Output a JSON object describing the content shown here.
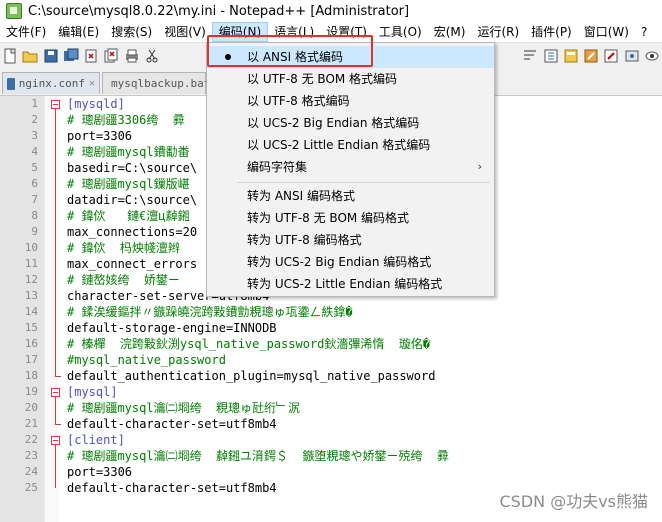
{
  "window": {
    "title": "C:\\source\\mysql8.0.22\\my.ini - Notepad++ [Administrator]"
  },
  "menubar": {
    "items": [
      "文件(F)",
      "编辑(E)",
      "搜索(S)",
      "视图(V)",
      "编码(N)",
      "语言(L)",
      "设置(T)",
      "工具(O)",
      "宏(M)",
      "运行(R)",
      "插件(P)",
      "窗口(W)",
      "?"
    ]
  },
  "tabs": [
    {
      "label": "nginx.conf"
    },
    {
      "label": "mysqlbackup.bat"
    }
  ],
  "encoding_menu": {
    "items": [
      {
        "label": "以 ANSI 格式编码",
        "checked": true
      },
      {
        "label": "以 UTF-8 无 BOM 格式编码"
      },
      {
        "label": "以 UTF-8 格式编码"
      },
      {
        "label": "以 UCS-2 Big Endian 格式编码"
      },
      {
        "label": "以 UCS-2 Little Endian 格式编码"
      },
      {
        "label": "编码字符集",
        "submenu": true
      },
      {
        "label": "转为 ANSI 编码格式"
      },
      {
        "label": "转为 UTF-8 无 BOM 编码格式"
      },
      {
        "label": "转为 UTF-8 编码格式"
      },
      {
        "label": "转为 UCS-2 Big Endian 编码格式"
      },
      {
        "label": "转为 UCS-2 Little Endian 编码格式"
      }
    ]
  },
  "editor": {
    "lines": [
      {
        "num": "1",
        "text": "[mysqld]",
        "kind": "section"
      },
      {
        "num": "2",
        "text": "# 璁剧疆3306绔  彛",
        "kind": "comment"
      },
      {
        "num": "3",
        "text": "port=3306",
        "kind": "normal"
      },
      {
        "num": "4",
        "text": "# 璁剧疆mysql鐨勫畨",
        "kind": "comment"
      },
      {
        "num": "5",
        "text": "basedir=C:\\source\\",
        "kind": "normal"
      },
      {
        "num": "6",
        "text": "# 璁剧疆mysql鏁版嵁",
        "kind": "comment"
      },
      {
        "num": "7",
        "text": "datadir=C:\\source\\",
        "kind": "normal"
      },
      {
        "num": "8",
        "text": "# 鍏佽   鏈€澶ц繛鎺",
        "kind": "comment"
      },
      {
        "num": "9",
        "text": "max_connections=20",
        "kind": "normal"
      },
      {
        "num": "10",
        "text": "# 鍏佽  杩炴帴澶辫",
        "kind": "comment"
      },
      {
        "num": "11",
        "text": "max_connect_errors",
        "kind": "normal"
      },
      {
        "num": "12",
        "text": "# 鏈嶅姟绔  娇鐢ㄧ",
        "kind": "comment"
      },
      {
        "num": "13",
        "text": "character-set-server=utf8mb4",
        "kind": "normal"
      },
      {
        "num": "14",
        "text": "# 鍒涘缓鏂拌〃鏃跺皢浣跨敤鐨勯粯璁ゅ瓨鍌ㄥ紩鎿�",
        "kind": "comment"
      },
      {
        "num": "15",
        "text": "default-storage-engine=INNODB",
        "kind": "normal"
      },
      {
        "num": "16",
        "text": "# 榛樿  浣跨敤鈥渕ysql_native_password鈥濇彃浠惰  璇佲�",
        "kind": "comment"
      },
      {
        "num": "17",
        "text": "#mysql_native_password",
        "kind": "comment"
      },
      {
        "num": "18",
        "text": "default_authentication_plugin=mysql_native_password",
        "kind": "normal"
      },
      {
        "num": "19",
        "text": "[mysql]",
        "kind": "section"
      },
      {
        "num": "20",
        "text": "# 璁剧疆mysql瀹㈡埛绔  粯璁ゅ瓧绗﹂泦",
        "kind": "comment"
      },
      {
        "num": "21",
        "text": "default-character-set=utf8mb4",
        "kind": "normal"
      },
      {
        "num": "22",
        "text": "[client]",
        "kind": "section"
      },
      {
        "num": "23",
        "text": "# 璁剧疆mysql瀹㈡埛绔  繛鎺ユ湇鍔＄  鏃堕粯璁や娇鐢ㄧ殑绔  彛",
        "kind": "comment"
      },
      {
        "num": "24",
        "text": "port=3306",
        "kind": "normal"
      },
      {
        "num": "25",
        "text": "default-character-set=utf8mb4",
        "kind": "normal"
      }
    ]
  },
  "watermark": "CSDN @功夫vs熊猫",
  "colors": {
    "section": "#5050d0",
    "comment": "#008000",
    "highlight": "#e8302a"
  }
}
